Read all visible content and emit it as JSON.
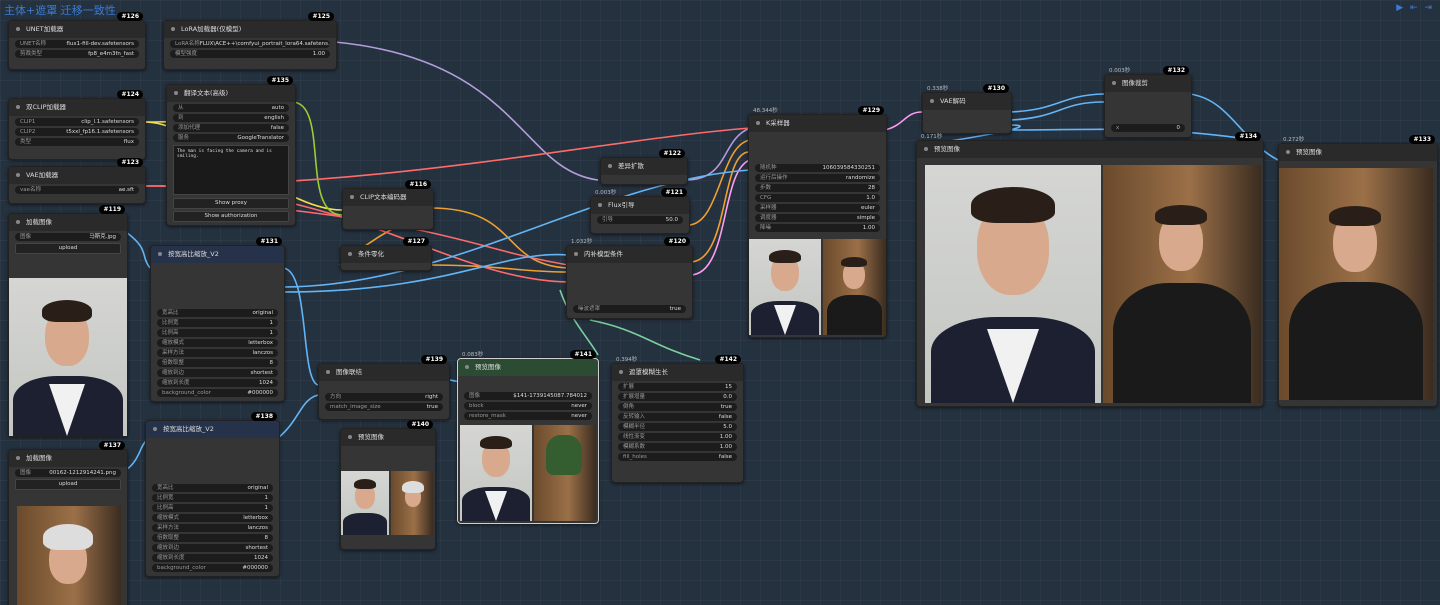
{
  "title": "主体+遮罩 迁移一致性",
  "top_controls": "▶ ⇤ ⇥",
  "colors": {
    "accent": "#3b7bd6",
    "node_bg": "#353535",
    "widget_bg": "#1c1c1c",
    "canvas_bg": "#24313e"
  },
  "nodes": {
    "n126": {
      "id": "#126",
      "title": "UNET加载器",
      "widgets": [
        {
          "label": "UNET名称",
          "value": "flux1-fill-dev.safetensors"
        },
        {
          "label": "剪裁类型",
          "value": "fp8_e4m3fn_fast"
        }
      ]
    },
    "n125": {
      "id": "#125",
      "title": "LoRA加载器(仅模型)",
      "widgets": [
        {
          "label": "LoRA名称",
          "value": "FLUX\\ACE++\\comfyui_portrait_lora64.safetens..."
        },
        {
          "label": "模型强度",
          "value": "1.00"
        }
      ]
    },
    "n135": {
      "id": "#135",
      "title": "翻译文本(高级)",
      "widgets": [
        {
          "label": "从",
          "value": "auto"
        },
        {
          "label": "到",
          "value": "english"
        },
        {
          "label": "添加代理",
          "value": "false"
        },
        {
          "label": "服务",
          "value": "GoogleTranslator"
        }
      ],
      "text": "The man is facing the camera and is smiling.",
      "buttons": [
        "Show proxy",
        "Show authorization"
      ]
    },
    "n124": {
      "id": "#124",
      "title": "双CLIP加载器",
      "widgets": [
        {
          "label": "CLIP1",
          "value": "clip_l.1.safetensors"
        },
        {
          "label": "CLIP2",
          "value": "t5xxl_fp16.1.safetensors"
        },
        {
          "label": "类型",
          "value": "flux"
        }
      ]
    },
    "n123": {
      "id": "#123",
      "title": "VAE加载器",
      "widgets": [
        {
          "label": "vae名称",
          "value": "ae.sft"
        }
      ]
    },
    "n119": {
      "id": "#119",
      "title": "加载图像",
      "widgets": [
        {
          "label": "图像",
          "value": "马斯克.jpg"
        }
      ],
      "button": "upload"
    },
    "n131": {
      "id": "#131",
      "title": "按宽高比缩放_V2",
      "widgets": [
        {
          "label": "宽高比",
          "value": "original"
        },
        {
          "label": "比例宽",
          "value": "1"
        },
        {
          "label": "比例高",
          "value": "1"
        },
        {
          "label": "缩放模式",
          "value": "letterbox"
        },
        {
          "label": "采样方法",
          "value": "lanczos"
        },
        {
          "label": "倍数取整",
          "value": "8"
        },
        {
          "label": "缩放到边",
          "value": "shortest"
        },
        {
          "label": "缩放到长度",
          "value": "1024"
        },
        {
          "label": "background_color",
          "value": "#000000"
        }
      ]
    },
    "n138": {
      "id": "#138",
      "title": "按宽高比缩放_V2",
      "widgets": [
        {
          "label": "宽高比",
          "value": "original"
        },
        {
          "label": "比例宽",
          "value": "1"
        },
        {
          "label": "比例高",
          "value": "1"
        },
        {
          "label": "缩放模式",
          "value": "letterbox"
        },
        {
          "label": "采样方法",
          "value": "lanczos"
        },
        {
          "label": "倍数取整",
          "value": "8"
        },
        {
          "label": "缩放到边",
          "value": "shortest"
        },
        {
          "label": "缩放到长度",
          "value": "1024"
        },
        {
          "label": "background_color",
          "value": "#000000"
        }
      ]
    },
    "n137": {
      "id": "#137",
      "title": "加载图像",
      "widgets": [
        {
          "label": "图像",
          "value": "00162-1212914241.png"
        }
      ],
      "button": "upload"
    },
    "n116": {
      "id": "#116",
      "title": "CLIP文本编码器"
    },
    "n127": {
      "id": "#127",
      "title": "条件零化"
    },
    "n122": {
      "id": "#122",
      "title": "差异扩散"
    },
    "n121": {
      "id": "#121",
      "title": "Flux引导",
      "timing": "0.003秒",
      "widgets": [
        {
          "label": "引导",
          "value": "50.0"
        }
      ]
    },
    "n120": {
      "id": "#120",
      "title": "内补模型条件",
      "timing": "1.032秒",
      "widgets": [
        {
          "label": "噪波遮罩",
          "value": "true"
        }
      ]
    },
    "n129": {
      "id": "#129",
      "title": "K采样器",
      "timing": "48.344秒",
      "widgets": [
        {
          "label": "随机种",
          "value": "106039584330251"
        },
        {
          "label": "运行后操作",
          "value": "randomize"
        },
        {
          "label": "步数",
          "value": "28"
        },
        {
          "label": "CFG",
          "value": "1.0"
        },
        {
          "label": "采样器",
          "value": "euler"
        },
        {
          "label": "调度器",
          "value": "simple"
        },
        {
          "label": "降噪",
          "value": "1.00"
        }
      ]
    },
    "n130": {
      "id": "#130",
      "title": "VAE解码",
      "timing": "0.338秒"
    },
    "n132": {
      "id": "#132",
      "title": "图像裁剪",
      "timing": "0.003秒",
      "widgets": [
        {
          "label": "x",
          "value": "0"
        }
      ]
    },
    "n134": {
      "id": "#134",
      "title": "预览图像",
      "timing": "0.171秒"
    },
    "n133": {
      "id": "#133",
      "title": "预览图像",
      "timing": "0.272秒"
    },
    "n139": {
      "id": "#139",
      "title": "图像联结",
      "widgets": [
        {
          "label": "方向",
          "value": "right"
        },
        {
          "label": "match_image_size",
          "value": "true"
        }
      ]
    },
    "n140": {
      "id": "#140",
      "title": "预览图像"
    },
    "n141": {
      "id": "#141",
      "title": "预览图像",
      "timing": "0.083秒",
      "widgets": [
        {
          "label": "图像",
          "value": "$141-1739145087.784012"
        },
        {
          "label": "block",
          "value": "never"
        },
        {
          "label": "restore_mask",
          "value": "never"
        }
      ]
    },
    "n142": {
      "id": "#142",
      "title": "遮罩模糊生长",
      "timing": "0.394秒",
      "widgets": [
        {
          "label": "扩展",
          "value": "15"
        },
        {
          "label": "扩展增量",
          "value": "0.0"
        },
        {
          "label": "倒角",
          "value": "true"
        },
        {
          "label": "反转输入",
          "value": "false"
        },
        {
          "label": "模糊半径",
          "value": "5.0"
        },
        {
          "label": "线性渐变",
          "value": "1.00"
        },
        {
          "label": "模糊系数",
          "value": "1.00"
        },
        {
          "label": "fill_holes",
          "value": "false"
        }
      ]
    }
  }
}
